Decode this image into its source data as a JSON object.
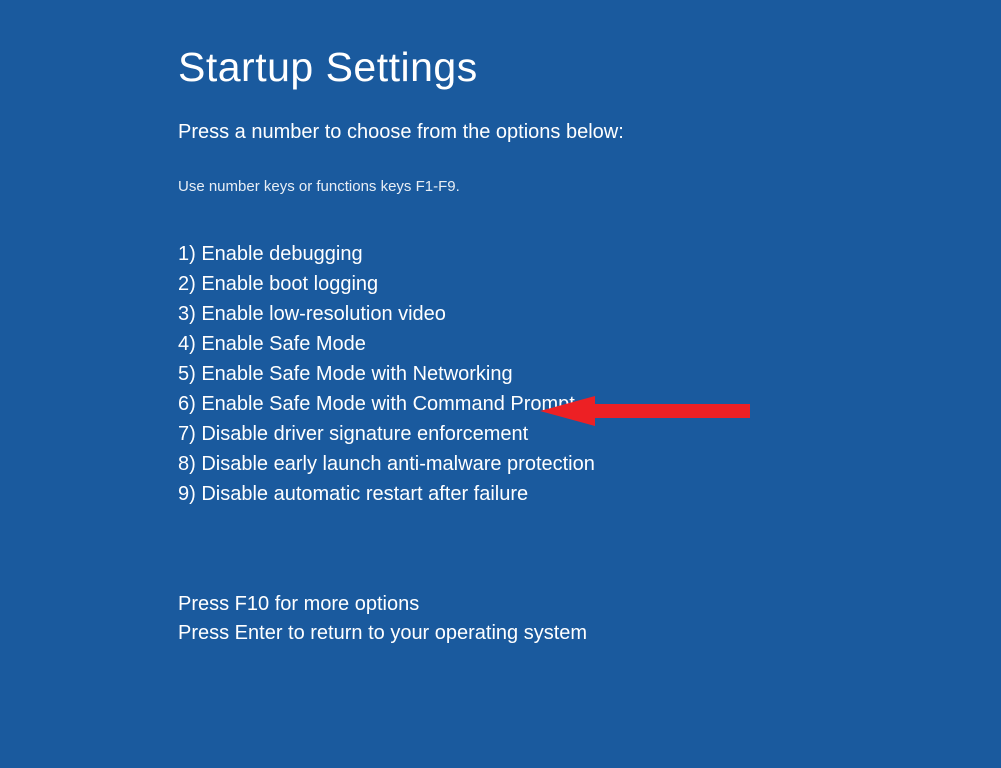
{
  "title": "Startup Settings",
  "instruction": "Press a number to choose from the options below:",
  "hint": "Use number keys or functions keys F1-F9.",
  "options": [
    "1) Enable debugging",
    "2) Enable boot logging",
    "3) Enable low-resolution video",
    "4) Enable Safe Mode",
    "5) Enable Safe Mode with Networking",
    "6) Enable Safe Mode with Command Prompt",
    "7) Disable driver signature enforcement",
    "8) Disable early launch anti-malware protection",
    "9) Disable automatic restart after failure"
  ],
  "footer": {
    "more_options": "Press F10 for more options",
    "return": "Press Enter to return to your operating system"
  },
  "arrow_color": "#ed2024"
}
